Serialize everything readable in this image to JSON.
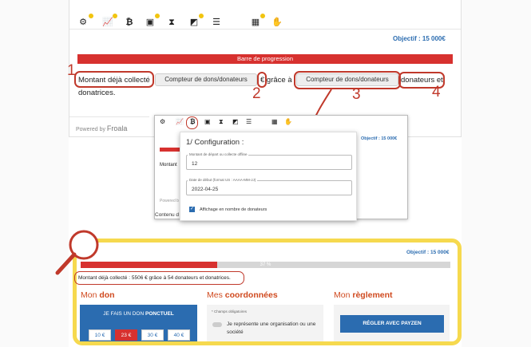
{
  "editor": {
    "objectif": "Objectif : 15 000€",
    "progress_bar_label": "Barre de progression",
    "line_prefix": "Montant déjà collecté :",
    "counter_button": "Compteur de dons/donateurs",
    "euro_suffix": "€ grâce à",
    "counter_button_2": "Compteur de dons/donateurs",
    "donors_suffix": "donateurs et",
    "line2": "donatrices.",
    "powered_by": "Powered by",
    "brand": "Froala",
    "toolbar_icons": [
      "gear-icon",
      "chart-icon",
      "bitcoin-icon",
      "id-card-icon",
      "hourglass-icon",
      "image-icon",
      "align-icon",
      "calculator-icon",
      "handshake-icon"
    ]
  },
  "annotations": {
    "n1": "1",
    "n2": "2",
    "n3": "3",
    "n4": "4",
    "color": "#c0392b"
  },
  "popup": {
    "objectif": "Objectif : 15 000€",
    "left_text": "Montant",
    "powered": "Powered b",
    "content_label": "Contenu d",
    "modal_title": "1/ Configuration :",
    "field1_label": "Montant de départ ou collecte offline",
    "field1_value": "12",
    "field2_label": "Date de début (format US : AAAA-MM-JJ)",
    "field2_value": "2022-04-25",
    "checkbox_label": "Affichage en nombre de donateurs"
  },
  "preview": {
    "objectif": "Objectif : 15 000€",
    "progress_percent": 37,
    "progress_label": "37 %",
    "summary": "Montant déjà collecté : 5506 € grâce à 54  donateurs et donatrices.",
    "col1_prefix": "Mon",
    "col1_bold": "don",
    "col2_prefix": "Mes",
    "col2_bold": "coordonnées",
    "col3_prefix": "Mon",
    "col3_bold": "règlement",
    "don_title_prefix": "JE FAIS UN DON",
    "don_title_bold": "PONCTUEL",
    "amounts": [
      "10 €",
      "23 €",
      "30 €",
      "40 €"
    ],
    "selected_amount_index": 1,
    "required": "* Champs obligatoires",
    "org_toggle": "Je représente une organisation ou une société",
    "pay_button": "RÉGLER AVEC PAYZEN",
    "accent": "#d7312f",
    "blue": "#2b6cb0",
    "highlight": "#f6d94e"
  }
}
